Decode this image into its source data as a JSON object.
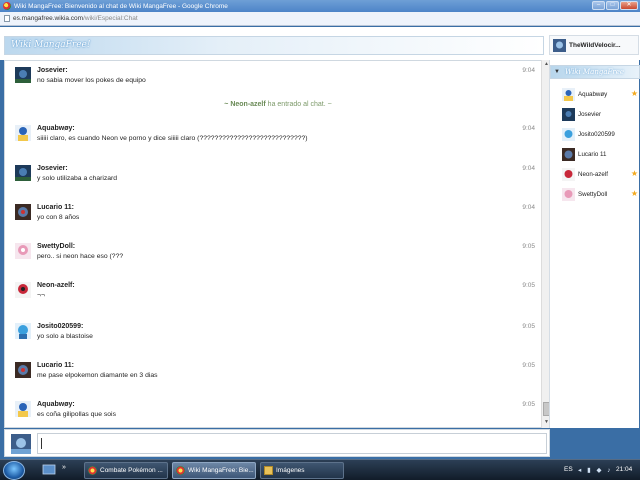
{
  "window": {
    "title": "Wiki MangaFree: Bienvenido al chat de Wiki MangaFree - Google Chrome",
    "url_host": "es.mangafree.wikia.com",
    "url_path": "/wiki/Especial:Chat"
  },
  "header": {
    "logo_text": "Wiki MangaFree!",
    "current_user": "TheWildVelocir..."
  },
  "messages": [
    {
      "user": "Josevier:",
      "text": "no sabia mover los pokes de equipo",
      "time": "9:04"
    },
    {
      "user": "Aquabwøy:",
      "text": "siiiii claro, es cuando Neon ve porno y dice siiiii claro (????????????????????????????)",
      "time": "9:04"
    },
    {
      "user": "Josevier:",
      "text": "y solo utilizaba a charizard",
      "time": "9:04"
    },
    {
      "user": "Lucario 11:",
      "text": "yo con 8 años",
      "time": "9:04"
    },
    {
      "user": "SwettyDoll:",
      "text": "pero.. si neon hace eso (???",
      "time": "9:05"
    },
    {
      "user": "Neon-azelf:",
      "text": "¬¬",
      "time": "9:05"
    },
    {
      "user": "Josito020599:",
      "text": "yo solo a blastoise",
      "time": "9:05"
    },
    {
      "user": "Lucario 11:",
      "text": "me pase elpokemon diamante en 3 dias",
      "time": "9:05"
    },
    {
      "user": "Aquabwøy:",
      "text": "es coña gilipollas que sois",
      "time": "9:05"
    }
  ],
  "inline_alert": {
    "user": "~ Neon-azelf",
    "text": "ha entrado al chat. ~"
  },
  "sidebar": {
    "header_label": "Wiki MangaFree",
    "members": [
      {
        "name": "Aquabwøy",
        "star": "★"
      },
      {
        "name": "Josevier",
        "star": ""
      },
      {
        "name": "Josito020599",
        "star": ""
      },
      {
        "name": "Lucario 11",
        "star": ""
      },
      {
        "name": "Neon-azelf",
        "star": "★"
      },
      {
        "name": "SwettyDoll",
        "star": "★"
      }
    ]
  },
  "taskbar": {
    "tasks": [
      "Combate Pokémon ...",
      "Wiki MangaFree: Bie...",
      "Imágenes"
    ],
    "lang": "ES",
    "time": "21:04"
  }
}
